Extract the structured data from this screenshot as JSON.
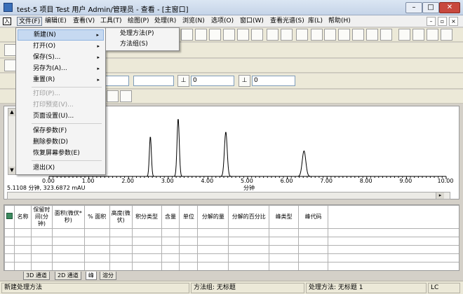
{
  "window": {
    "title": "test-5 项目 Test 用户 Admin/管理员 - 查看 - [主窗口]",
    "min": "–",
    "max": "□",
    "close": "✕"
  },
  "menubar": {
    "items": [
      "文件(F)",
      "编辑(E)",
      "查看(V)",
      "工具(T)",
      "绘图(P)",
      "处理(R)",
      "浏览(N)",
      "选项(O)",
      "窗口(W)",
      "查看光谱(S)",
      "库(L)",
      "帮助(H)"
    ],
    "mdi": [
      "–",
      "▫",
      "×"
    ]
  },
  "file_menu": {
    "new": "新建(N)",
    "open": "打开(O)",
    "save": "保存(S)...",
    "save_as": "另存为(A)...",
    "reset": "重置(R)",
    "print": "打印(P)...",
    "print_preview": "打印预览(V)...",
    "page_setup": "页面设置(U)...",
    "save_params": "保存参数(F)",
    "delete_params": "删除参数(D)",
    "restore_screen_params": "恢复屏幕参数(E)",
    "exit": "退出(X)",
    "arrow": "▸"
  },
  "new_submenu": {
    "processing_method": "处理方法(P)",
    "method_set": "方法组(S)"
  },
  "toolbar": {
    "field_1": "0",
    "field_2": "0"
  },
  "chart_data": {
    "type": "line",
    "xlabel": "分钟",
    "ylabel": "",
    "xlim": [
      0.0,
      10.0
    ],
    "ylim": [
      0,
      1
    ],
    "x_ticks": [
      "0.00",
      "1.00",
      "2.00",
      "3.00",
      "4.00",
      "5.00",
      "6.00",
      "7.00",
      "8.00",
      "9.00",
      "10.00"
    ],
    "peaks": [
      {
        "rt": 2.55,
        "height": 0.63,
        "width": 0.025
      },
      {
        "rt": 3.25,
        "height": 0.91,
        "width": 0.028
      },
      {
        "rt": 4.45,
        "height": 0.7,
        "width": 0.035
      },
      {
        "rt": 6.42,
        "height": 0.4,
        "width": 0.045
      }
    ],
    "cursor_readout": "5.1108 分钟, 323.6872 mAU",
    "grid": false
  },
  "table": {
    "headers": [
      "名称",
      "保留时间(分钟)",
      "面积(微伏*秒)",
      "% 面积",
      "高度(微伏)",
      "积分类型",
      "含量",
      "单位",
      "分解的量",
      "分解的百分比",
      "峰类型",
      "峰代码"
    ],
    "row_count": 6
  },
  "tabs": [
    "3D 通道",
    "2D 通道",
    "峰",
    "溶分"
  ],
  "status": {
    "left": "新建处理方法",
    "method_set": "方法组: 无标题",
    "processing_method": "处理方法: 无标题 1",
    "lc": "LC"
  },
  "icons": {
    "scroll_up": "▲",
    "scroll_down": "▼",
    "scroll_right": "▸"
  }
}
